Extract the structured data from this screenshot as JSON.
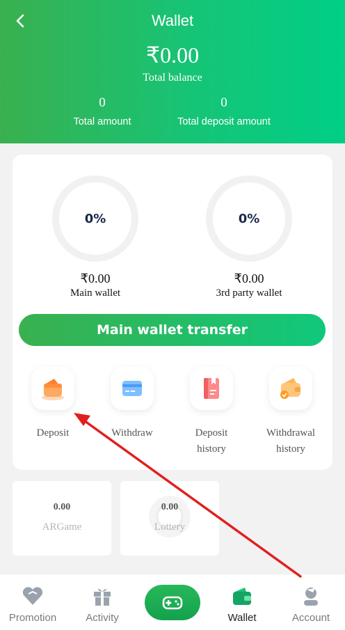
{
  "header": {
    "title": "Wallet",
    "total_balance": "₹0.00",
    "total_balance_label": "Total balance",
    "total_amount": "0",
    "total_amount_label": "Total amount",
    "total_deposit_amount": "0",
    "total_deposit_amount_label": "Total deposit amount"
  },
  "wallets": {
    "main": {
      "percent": "0%",
      "amount": "₹0.00",
      "label": "Main wallet"
    },
    "third_party": {
      "percent": "0%",
      "amount": "₹0.00",
      "label": "3rd party wallet"
    }
  },
  "transfer_button": "Main wallet transfer",
  "actions": [
    {
      "line1": "Deposit",
      "line2": ""
    },
    {
      "line1": "Withdraw",
      "line2": ""
    },
    {
      "line1": "Deposit",
      "line2": "history"
    },
    {
      "line1": "Withdrawal",
      "line2": "history"
    }
  ],
  "games": [
    {
      "value": "0.00",
      "name": "ARGame"
    },
    {
      "value": "0.00",
      "name": "Lottery"
    }
  ],
  "tabbar": [
    {
      "label": "Promotion",
      "icon": "diamond-heart-icon"
    },
    {
      "label": "Activity",
      "icon": "gift-icon"
    },
    {
      "label": "Wallet",
      "icon": "wallet-icon"
    },
    {
      "label": "Account",
      "icon": "account-icon"
    }
  ],
  "colors": {
    "brand_green": "#16c476",
    "annotation_arrow": "#e0201e"
  }
}
